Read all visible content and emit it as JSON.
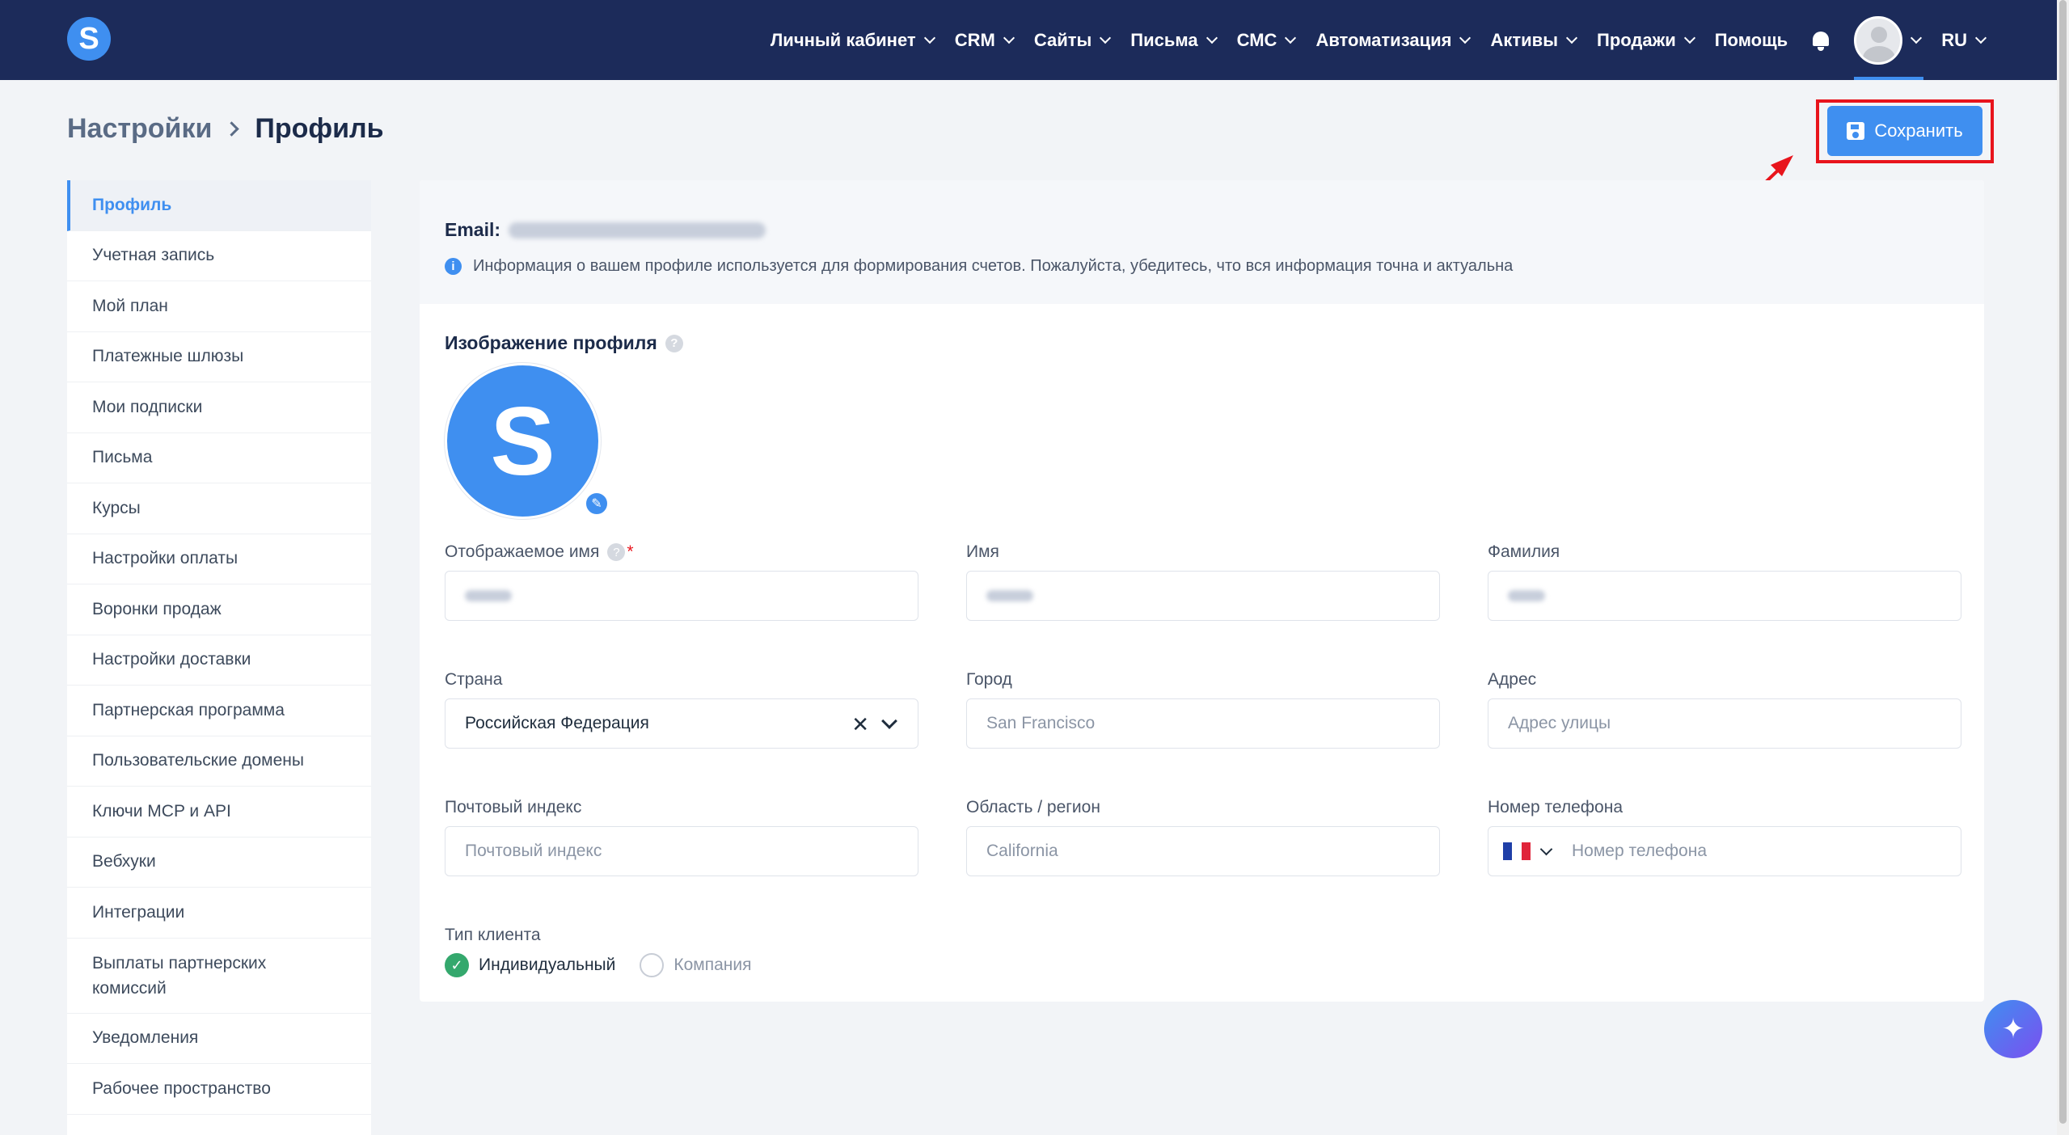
{
  "brand": {
    "logo_letter": "S"
  },
  "nav": {
    "items": [
      {
        "label": "Личный кабинет",
        "has_dropdown": true
      },
      {
        "label": "CRM",
        "has_dropdown": true
      },
      {
        "label": "Сайты",
        "has_dropdown": true
      },
      {
        "label": "Письма",
        "has_dropdown": true
      },
      {
        "label": "СМС",
        "has_dropdown": true
      },
      {
        "label": "Автоматизация",
        "has_dropdown": true
      },
      {
        "label": "Активы",
        "has_dropdown": true
      },
      {
        "label": "Продажи",
        "has_dropdown": true
      },
      {
        "label": "Помощь",
        "has_dropdown": false
      }
    ],
    "language": "RU",
    "bell_icon": "bell-icon",
    "avatar_icon": "user-avatar-icon"
  },
  "breadcrumb": {
    "parent": "Настройки",
    "current": "Профиль"
  },
  "toolbar": {
    "save_label": "Сохранить",
    "save_icon": "floppy-disk-icon"
  },
  "sidebar": {
    "items": [
      {
        "label": "Профиль",
        "active": true
      },
      {
        "label": "Учетная запись"
      },
      {
        "label": "Мой план"
      },
      {
        "label": "Платежные шлюзы"
      },
      {
        "label": "Мои подписки"
      },
      {
        "label": "Письма"
      },
      {
        "label": "Курсы"
      },
      {
        "label": "Настройки оплаты"
      },
      {
        "label": "Воронки продаж"
      },
      {
        "label": "Настройки доставки"
      },
      {
        "label": "Партнерская программа"
      },
      {
        "label": "Пользовательские домены"
      },
      {
        "label": "Ключи MCP и API"
      },
      {
        "label": "Вебхуки"
      },
      {
        "label": "Интеграции"
      },
      {
        "label": "Выплаты партнерских комиссий"
      },
      {
        "label": "Уведомления"
      },
      {
        "label": "Рабочее пространство"
      }
    ]
  },
  "profile": {
    "email_label": "Email:",
    "info_text": "Информация о вашем профиле используется для формирования счетов. Пожалуйста, убедитесь, что вся информация точна и актуальна",
    "image_title": "Изображение профиля",
    "image_letter": "S",
    "fields": {
      "display_name": {
        "label": "Отображаемое имя",
        "required": "*"
      },
      "first_name": {
        "label": "Имя"
      },
      "last_name": {
        "label": "Фамилия"
      },
      "country": {
        "label": "Страна",
        "value": "Российская Федерация",
        "clear": "✕"
      },
      "city": {
        "label": "Город",
        "placeholder": "San Francisco"
      },
      "address": {
        "label": "Адрес",
        "placeholder": "Адрес улицы"
      },
      "postal": {
        "label": "Почтовый индекс",
        "placeholder": "Почтовый индекс"
      },
      "region": {
        "label": "Область / регион",
        "placeholder": "California"
      },
      "phone": {
        "label": "Номер телефона",
        "placeholder": "Номер телефона"
      }
    },
    "client_type": {
      "label": "Тип клиента",
      "options": [
        {
          "label": "Индивидуальный",
          "selected": true
        },
        {
          "label": "Компания",
          "selected": false
        }
      ]
    }
  },
  "colors": {
    "nav_bg": "#1c2b5a",
    "accent": "#3f8ff0",
    "highlight": "#e8141c",
    "success": "#34a86d"
  },
  "fab_icon": "sparkle-icon"
}
